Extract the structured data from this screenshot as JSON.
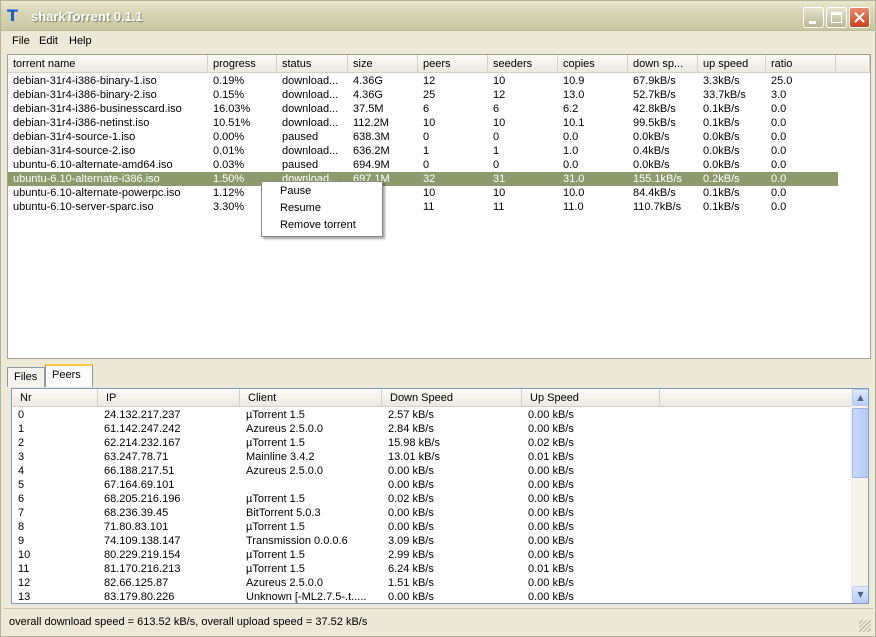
{
  "window": {
    "title": "sharkTorrent 0.1.1",
    "app_icon_glyph": "T"
  },
  "menu": [
    "File",
    "Edit",
    "Help"
  ],
  "torrents": {
    "columns": [
      "torrent name",
      "progress",
      "status",
      "size",
      "peers",
      "seeders",
      "copies",
      "down sp...",
      "up speed",
      "ratio"
    ],
    "rows": [
      [
        "debian-31r4-i386-binary-1.iso",
        "0.19%",
        "download...",
        "4.36G",
        "12",
        "10",
        "10.9",
        "67.9kB/s",
        "3.3kB/s",
        "25.0"
      ],
      [
        "debian-31r4-i386-binary-2.iso",
        "0.15%",
        "download...",
        "4.36G",
        "25",
        "12",
        "13.0",
        "52.7kB/s",
        "33.7kB/s",
        "3.0"
      ],
      [
        "debian-31r4-i386-businesscard.iso",
        "16.03%",
        "download...",
        "37.5M",
        "6",
        "6",
        "6.2",
        "42.8kB/s",
        "0.1kB/s",
        "0.0"
      ],
      [
        "debian-31r4-i386-netinst.iso",
        "10.51%",
        "download...",
        "112.2M",
        "10",
        "10",
        "10.1",
        "99.5kB/s",
        "0.1kB/s",
        "0.0"
      ],
      [
        "debian-31r4-source-1.iso",
        "0.00%",
        "paused",
        "638.3M",
        "0",
        "0",
        "0.0",
        "0.0kB/s",
        "0.0kB/s",
        "0.0"
      ],
      [
        "debian-31r4-source-2.iso",
        "0.01%",
        "download...",
        "636.2M",
        "1",
        "1",
        "1.0",
        "0.4kB/s",
        "0.0kB/s",
        "0.0"
      ],
      [
        "ubuntu-6.10-alternate-amd64.iso",
        "0.03%",
        "paused",
        "694.9M",
        "0",
        "0",
        "0.0",
        "0.0kB/s",
        "0.0kB/s",
        "0.0"
      ],
      [
        "ubuntu-6.10-alternate-i386.iso",
        "1.50%",
        "download...",
        "697.1M",
        "32",
        "31",
        "31.0",
        "155.1kB/s",
        "0.2kB/s",
        "0.0"
      ],
      [
        "ubuntu-6.10-alternate-powerpc.iso",
        "1.12%",
        "",
        "M",
        "10",
        "10",
        "10.0",
        "84.4kB/s",
        "0.1kB/s",
        "0.0"
      ],
      [
        "ubuntu-6.10-server-sparc.iso",
        "3.30%",
        "",
        "M",
        "11",
        "11",
        "11.0",
        "110.7kB/s",
        "0.1kB/s",
        "0.0"
      ]
    ],
    "selected_index": 7
  },
  "context_menu": {
    "items": [
      "Pause",
      "Resume",
      "Remove torrent"
    ]
  },
  "tabs": [
    "Files",
    "Peers"
  ],
  "active_tab": "Peers",
  "peers": {
    "columns": [
      "Nr",
      "IP",
      "Client",
      "Down Speed",
      "Up Speed"
    ],
    "rows": [
      [
        "0",
        "24.132.217.237",
        "µTorrent 1.5",
        "2.57 kB/s",
        "0.00 kB/s"
      ],
      [
        "1",
        "61.142.247.242",
        "Azureus 2.5.0.0",
        "2.84 kB/s",
        "0.00 kB/s"
      ],
      [
        "2",
        "62.214.232.167",
        "µTorrent 1.5",
        "15.98 kB/s",
        "0.02 kB/s"
      ],
      [
        "3",
        "63.247.78.71",
        "Mainline 3.4.2",
        "13.01 kB/s",
        "0.01 kB/s"
      ],
      [
        "4",
        "66.188.217.51",
        "Azureus 2.5.0.0",
        "0.00 kB/s",
        "0.00 kB/s"
      ],
      [
        "5",
        "67.164.69.101",
        "",
        "0.00 kB/s",
        "0.00 kB/s"
      ],
      [
        "6",
        "68.205.216.196",
        "µTorrent 1.5",
        "0.02 kB/s",
        "0.00 kB/s"
      ],
      [
        "7",
        "68.236.39.45",
        "BitTorrent 5.0.3",
        "0.00 kB/s",
        "0.00 kB/s"
      ],
      [
        "8",
        "71.80.83.101",
        "µTorrent 1.5",
        "0.00 kB/s",
        "0.00 kB/s"
      ],
      [
        "9",
        "74.109.138.147",
        "Transmission 0.0.0.6",
        "3.09 kB/s",
        "0.00 kB/s"
      ],
      [
        "10",
        "80.229.219.154",
        "µTorrent 1.5",
        "2.99 kB/s",
        "0.00 kB/s"
      ],
      [
        "11",
        "81.170.216.213",
        "µTorrent 1.5",
        "6.24 kB/s",
        "0.01 kB/s"
      ],
      [
        "12",
        "82.66.125.87",
        "Azureus 2.5.0.0",
        "1.51 kB/s",
        "0.00 kB/s"
      ],
      [
        "13",
        "83.179.80.226",
        "Unknown [-ML2.7.5-.t.....",
        "0.00 kB/s",
        "0.00 kB/s"
      ]
    ]
  },
  "status": {
    "text": "overall download speed = 613.52 kB/s, overall upload speed = 37.52 kB/s"
  },
  "colors": {
    "selection": "#8c9a6c",
    "window_bg": "#ece9d8",
    "active_tab_accent": "#ffc83c",
    "title_icon": "#1e5ac8"
  },
  "icons": {
    "app": "app-logo-icon",
    "minimize": "minimize-icon",
    "maximize": "maximize-icon",
    "close": "close-icon",
    "scroll_up": "scroll-up-arrow-icon",
    "scroll_down": "scroll-down-arrow-icon",
    "resize_grip": "resize-grip-icon"
  }
}
